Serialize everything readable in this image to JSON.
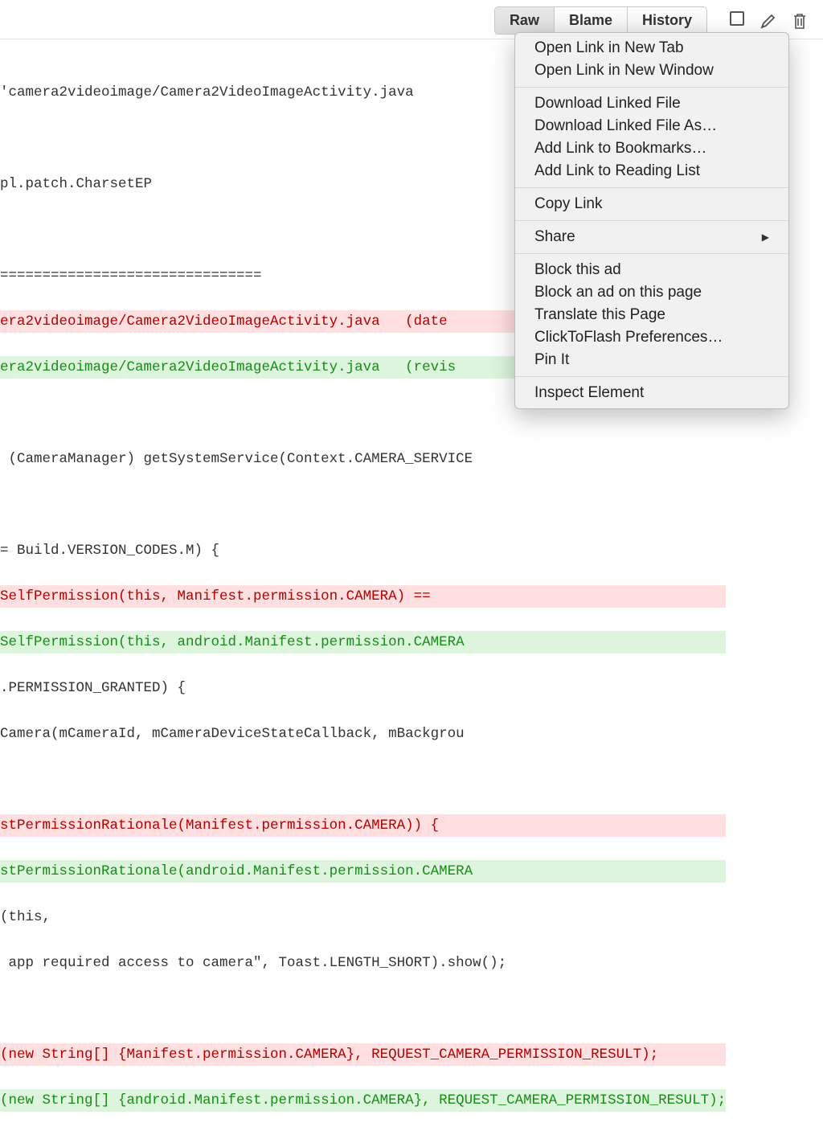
{
  "toolbar": {
    "raw": "Raw",
    "blame": "Blame",
    "history": "History"
  },
  "code": {
    "l0": "'camera2videoimage/Camera2VideoImageActivity.java",
    "l1": "",
    "l2": "pl.patch.CharsetEP",
    "l3": "",
    "l4": "===============================",
    "l5": "era2videoimage/Camera2VideoImageActivity.java\t(date ",
    "l6": "era2videoimage/Camera2VideoImageActivity.java\t(revis",
    "l7": "",
    "l8": " (CameraManager) getSystemService(Context.CAMERA_SERVICE",
    "l9": "",
    "l10": "= Build.VERSION_CODES.M) {",
    "l11": "SelfPermission(this, Manifest.permission.CAMERA) ==",
    "l12": "SelfPermission(this, android.Manifest.permission.CAMERA",
    "l13": ".PERMISSION_GRANTED) {",
    "l14": "Camera(mCameraId, mCameraDeviceStateCallback, mBackgrou",
    "l15": "",
    "l16": "stPermissionRationale(Manifest.permission.CAMERA)) {",
    "l17": "stPermissionRationale(android.Manifest.permission.CAMERA",
    "l18": "(this,",
    "l19": " app required access to camera\", Toast.LENGTH_SHORT).show();",
    "l20": "",
    "l21": "(new String[] {Manifest.permission.CAMERA}, REQUEST_CAMERA_PERMISSION_RESULT);",
    "l22": "(new String[] {android.Manifest.permission.CAMERA}, REQUEST_CAMERA_PERMISSION_RESULT);"
  },
  "menu": {
    "openNewTab": "Open Link in New Tab",
    "openNewWindow": "Open Link in New Window",
    "downloadLinked": "Download Linked File",
    "downloadLinkedAs": "Download Linked File As…",
    "addBookmarks": "Add Link to Bookmarks…",
    "addReadingList": "Add Link to Reading List",
    "copyLink": "Copy Link",
    "share": "Share",
    "blockAd": "Block this ad",
    "blockAdPage": "Block an ad on this page",
    "translate": "Translate this Page",
    "clickToFlash": "ClickToFlash Preferences…",
    "pinIt": "Pin It",
    "inspect": "Inspect Element"
  }
}
